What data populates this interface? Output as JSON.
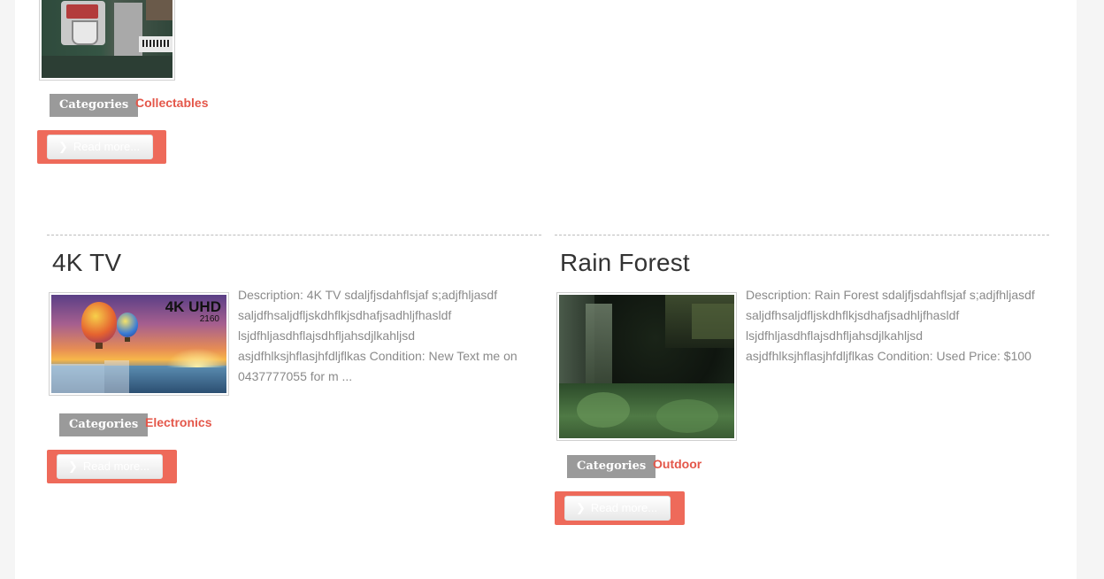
{
  "items": [
    {
      "title": "",
      "image_icon": "coffee-maker-photo",
      "categories_label": "Categories",
      "category": "Collectables",
      "read_more": "Read more..."
    },
    {
      "title": "4K TV",
      "image_icon": "4k-tv-photo",
      "image_text": "4K UHD",
      "image_subtext": "2160",
      "description": "Description: 4K TV sdaljfjsdahflsjaf s;adjfhljasdf saljdfhsaljdfljskdhflkjsdhafjsadhljfhasldf lsjdfhljasdhflajsdhfljahsdjlkahljsd asjdfhlksjhflasjhfdljflkas Condition: New Text me on 0437777055 for m ...",
      "categories_label": "Categories",
      "category": "Electronics",
      "read_more": "Read more..."
    },
    {
      "title": "Rain Forest",
      "image_icon": "rain-forest-photo",
      "description": "Description: Rain Forest sdaljfjsdahflsjaf s;adjfhljasdf saljdfhsaljdfljskdhflkjsdhafjsadhljfhasldf lsjdfhljasdhflajsdhfljahsdjlkahljsd asjdfhlksjhflasjhfdljflkas Condition: Used Price: $100",
      "categories_label": "Categories",
      "category": "Outdoor",
      "read_more": "Read more..."
    }
  ],
  "colors": {
    "accent": "#ee6a5a",
    "link": "#e4574a",
    "badge": "#9a9a9a",
    "page_bg": "#f5f5f5"
  }
}
